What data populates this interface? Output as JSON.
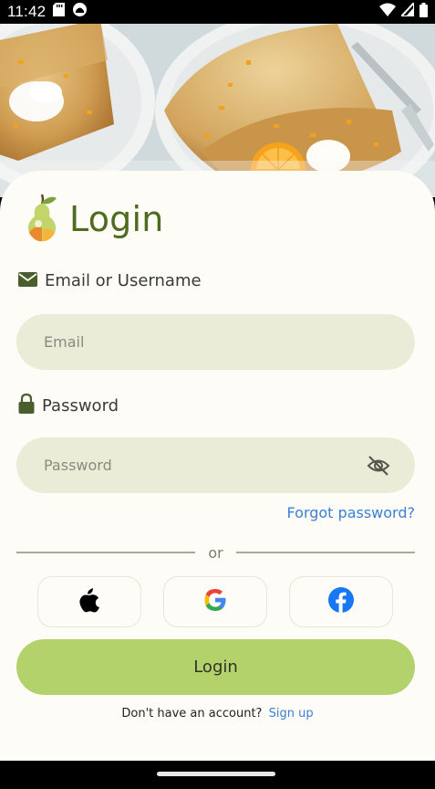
{
  "status_bar": {
    "time": "11:42",
    "icons": [
      "sd-card-icon",
      "notification-icon",
      "wifi-icon",
      "signal-icon",
      "battery-icon"
    ]
  },
  "header": {
    "title": "Login",
    "logo": "pear-logo-icon"
  },
  "form": {
    "email": {
      "label": "Email or Username",
      "icon": "mail-icon",
      "placeholder": "Email",
      "value": ""
    },
    "password": {
      "label": "Password",
      "icon": "lock-icon",
      "placeholder": "Password",
      "value": "",
      "toggle_icon": "eye-off-icon"
    },
    "forgot_password": "Forgot password?",
    "divider": "or",
    "social": [
      {
        "name": "apple",
        "icon": "apple-icon"
      },
      {
        "name": "google",
        "icon": "google-icon"
      },
      {
        "name": "facebook",
        "icon": "facebook-icon"
      }
    ],
    "submit_label": "Login",
    "signup_prompt": "Don't have an account?",
    "signup_link": "Sign up"
  },
  "colors": {
    "title": "#4f6b1f",
    "input_bg": "#ebecd8",
    "button_bg": "#b4d26b",
    "link": "#3b7fd8",
    "card_bg": "#fdfcf6"
  }
}
